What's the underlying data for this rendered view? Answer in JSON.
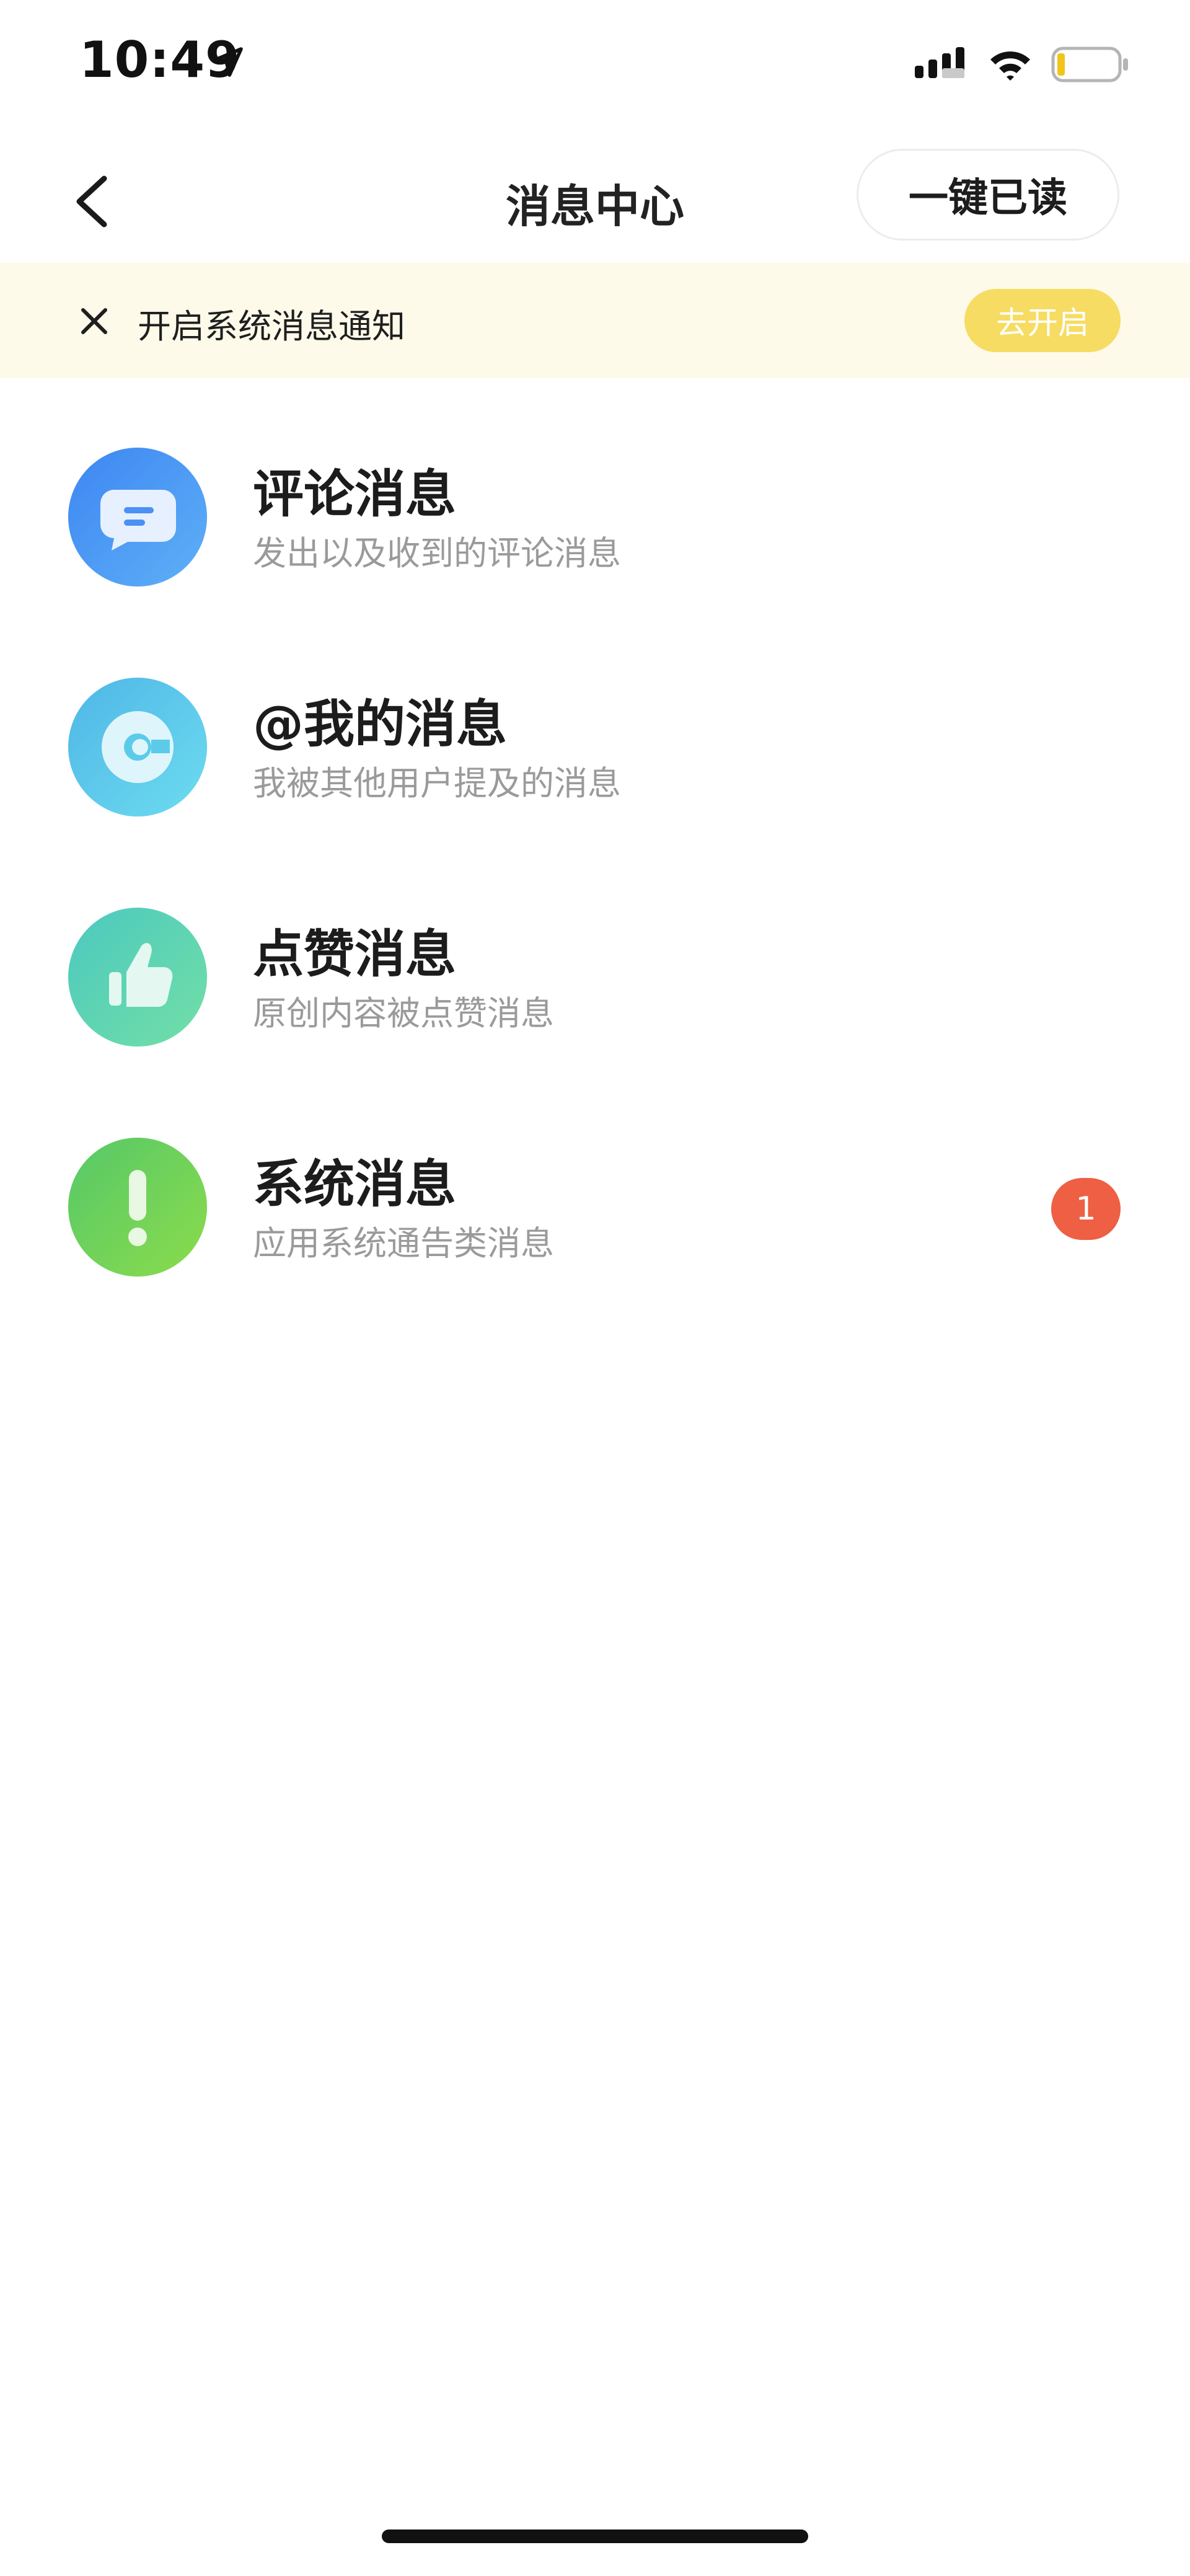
{
  "status_bar": {
    "time": "10:49"
  },
  "nav": {
    "title": "消息中心",
    "read_all_label": "一键已读"
  },
  "banner": {
    "text": "开启系统消息通知",
    "enable_label": "去开启",
    "accent": "#f7dc63",
    "background": "#fefaea"
  },
  "messages": [
    {
      "title": "评论消息",
      "subtitle": "发出以及收到的评论消息",
      "icon": "comment-icon",
      "color": "#4a90f5"
    },
    {
      "title": "@我的消息",
      "subtitle": "我被其他用户提及的消息",
      "icon": "at-icon",
      "color": "#5ccbea"
    },
    {
      "title": "点赞消息",
      "subtitle": "原创内容被点赞消息",
      "icon": "thumbs-up-icon",
      "color": "#5dd6b0"
    },
    {
      "title": "系统消息",
      "subtitle": "应用系统通告类消息",
      "icon": "exclamation-icon",
      "color": "#6fd35e",
      "badge": "1"
    }
  ]
}
